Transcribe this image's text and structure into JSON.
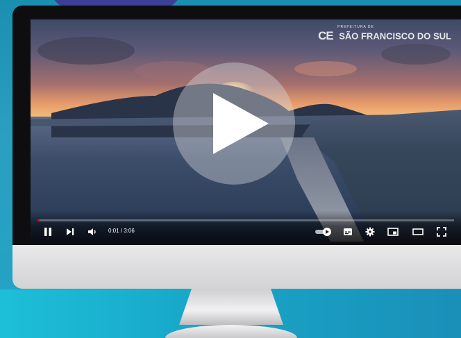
{
  "video": {
    "channel_small": "PREFEITURA DE",
    "channel_mark": "CE",
    "channel_name": "SÃO FRANCISCO DO SUL",
    "progress": 0.005,
    "time_display": "0:01 / 3:06"
  },
  "icons": {
    "play_overlay": "play-icon",
    "pause": "pause-icon",
    "next": "next-icon",
    "volume": "volume-icon",
    "autoplay": "autoplay-toggle-icon",
    "subtitles": "subtitles-icon",
    "settings": "gear-icon",
    "miniplayer": "miniplayer-icon",
    "theater": "theater-icon",
    "fullscreen": "fullscreen-icon"
  },
  "colors": {
    "progress": "#ff0000",
    "background": "#1a8fb0"
  }
}
